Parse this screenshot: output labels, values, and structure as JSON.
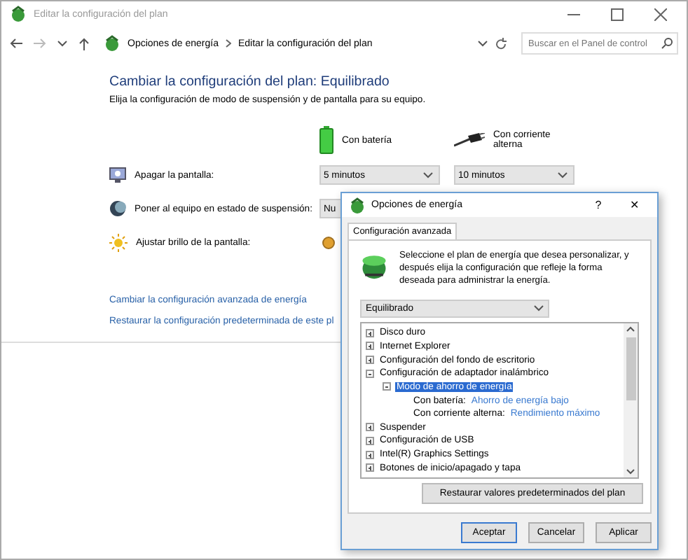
{
  "window": {
    "title": "Editar la configuración del plan"
  },
  "address_bar": {
    "breadcrumbs": [
      "Opciones de energía",
      "Editar la configuración del plan"
    ]
  },
  "search": {
    "placeholder": "Buscar en el Panel de control"
  },
  "heading": "Cambiar la configuración del plan: Equilibrado",
  "subheading": "Elija la configuración de modo de suspensión y de pantalla para su equipo.",
  "columns": [
    {
      "label": "Con batería",
      "kind": "battery"
    },
    {
      "label": "Con corriente alterna",
      "kind": "plug"
    }
  ],
  "settings": [
    {
      "label": "Apagar la pantalla:",
      "kind": "dropdowns",
      "values": [
        "5 minutos",
        "10 minutos"
      ]
    },
    {
      "label": "Poner al equipo en estado de suspensión:",
      "kind": "dropdowns",
      "values": [
        "Nu"
      ]
    },
    {
      "label": "Ajustar brillo de la pantalla:",
      "kind": "slider"
    }
  ],
  "links": [
    "Cambiar la configuración avanzada de energía",
    "Restaurar la configuración predeterminada de este pl"
  ],
  "dialog": {
    "title": "Opciones de energía",
    "help": "?",
    "close": "✕",
    "tabs": [
      {
        "label": "Configuración avanzada",
        "selected": true
      }
    ],
    "intro": "Seleccione el plan de energía que desea personalizar, y después elija la configuración que refleje la forma deseada para administrar la energía.",
    "plan": "Equilibrado",
    "tree": [
      {
        "label": "Disco duro",
        "expanded": false,
        "selected": false
      },
      {
        "label": "Internet Explorer",
        "expanded": false,
        "selected": false
      },
      {
        "label": "Configuración del fondo de escritorio",
        "expanded": false,
        "selected": false
      },
      {
        "label": "Configuración de adaptador inalámbrico",
        "expanded": true,
        "selected": false,
        "children": [
          {
            "label": "Modo de ahorro de energía",
            "expanded": true,
            "selected": true,
            "children": [
              {
                "label": "Con batería:",
                "value": "Ahorro de energía bajo",
                "selected": false
              },
              {
                "label": "Con corriente alterna:",
                "value": "Rendimiento máximo",
                "selected": false
              }
            ]
          }
        ]
      },
      {
        "label": "Suspender",
        "expanded": false,
        "selected": false
      },
      {
        "label": "Configuración de USB",
        "expanded": false,
        "selected": false
      },
      {
        "label": "Intel(R) Graphics Settings",
        "expanded": false,
        "selected": false
      },
      {
        "label": "Botones de inicio/apagado y tapa",
        "expanded": false,
        "selected": false
      }
    ],
    "restore_button": "Restaurar valores predeterminados del plan",
    "buttons": [
      {
        "label": "Aceptar",
        "default": true
      },
      {
        "label": "Cancelar",
        "default": false
      },
      {
        "label": "Aplicar",
        "default": false
      }
    ]
  }
}
